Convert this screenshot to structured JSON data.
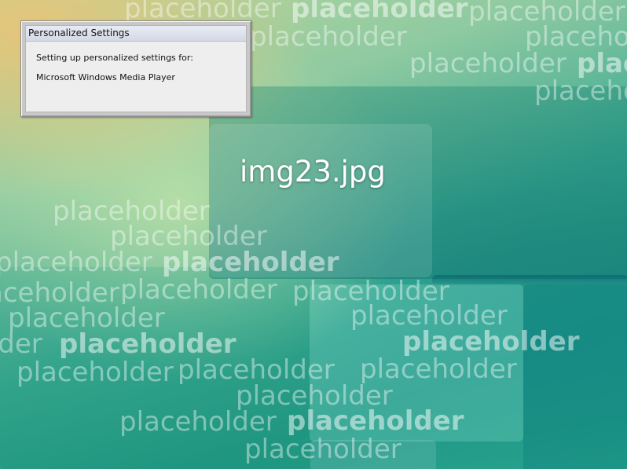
{
  "desktop": {
    "wallpaper_title": "img23.jpg",
    "watermark_word": "placeholder",
    "colors": {
      "teal": "#1f9585",
      "mint": "#8fcaa1",
      "sand": "#e8c478"
    }
  },
  "dialog": {
    "title": "Personalized Settings",
    "message": "Setting up personalized settings for:",
    "product": "Microsoft Windows Media Player"
  }
}
